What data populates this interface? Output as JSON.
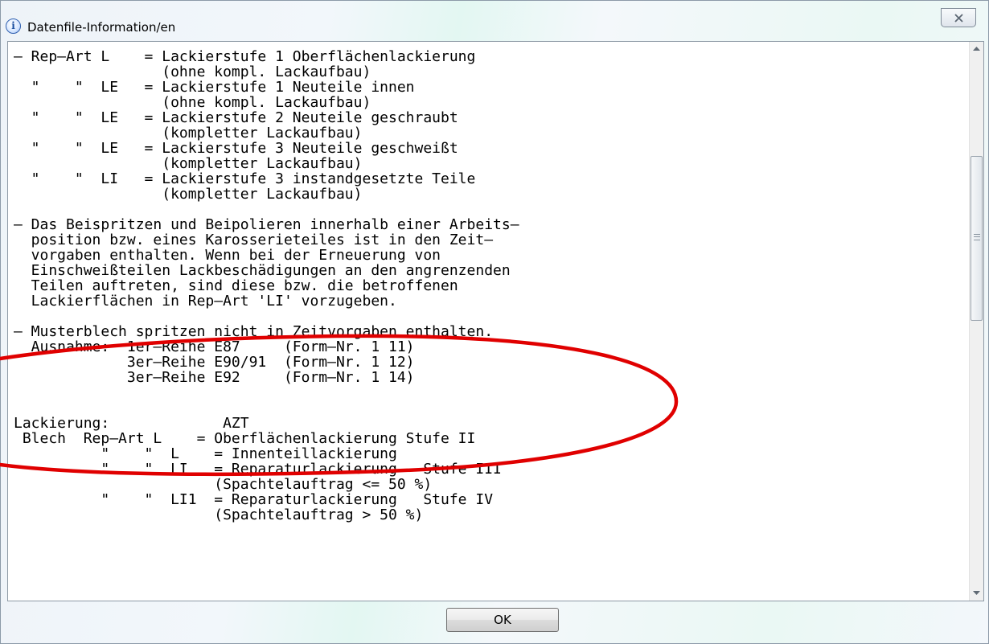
{
  "window": {
    "title": "Datenfile-Information/en",
    "info_icon_glyph": "i",
    "close_icon": "close-icon"
  },
  "content": {
    "lines": [
      "– Rep–Art L    = Lackierstufe 1 Oberflächenlackierung",
      "                 (ohne kompl. Lackaufbau)",
      "  \"    \"  LE   = Lackierstufe 1 Neuteile innen",
      "                 (ohne kompl. Lackaufbau)",
      "  \"    \"  LE   = Lackierstufe 2 Neuteile geschraubt",
      "                 (kompletter Lackaufbau)",
      "  \"    \"  LE   = Lackierstufe 3 Neuteile geschweißt",
      "                 (kompletter Lackaufbau)",
      "  \"    \"  LI   = Lackierstufe 3 instandgesetzte Teile",
      "                 (kompletter Lackaufbau)",
      "",
      "– Das Beispritzen und Beipolieren innerhalb einer Arbeits–",
      "  position bzw. eines Karosserieteiles ist in den Zeit–",
      "  vorgaben enthalten. Wenn bei der Erneuerung von",
      "  Einschweißteilen Lackbeschädigungen an den angrenzenden",
      "  Teilen auftreten, sind diese bzw. die betroffenen",
      "  Lackierflächen in Rep–Art 'LI' vorzugeben.",
      "",
      "– Musterblech spritzen nicht in Zeitvorgaben enthalten.",
      "  Ausnahme:  1er–Reihe E87     (Form–Nr. 1 11)",
      "             3er–Reihe E90/91  (Form–Nr. 1 12)",
      "             3er–Reihe E92     (Form–Nr. 1 14)",
      "",
      "",
      "Lackierung:             AZT",
      " Blech  Rep–Art L    = Oberflächenlackierung Stufe II",
      "          \"    \"  L    = Innenteillackierung",
      "          \"    \"  LI   = Reparaturlackierung   Stufe III",
      "                       (Spachtelauftrag <= 50 %)",
      "          \"    \"  LI1  = Reparaturlackierung   Stufe IV",
      "                       (Spachtelauftrag > 50 %)"
    ]
  },
  "footer": {
    "ok_label": "OK"
  },
  "colors": {
    "annotation": "#e00000",
    "text": "#000000"
  }
}
